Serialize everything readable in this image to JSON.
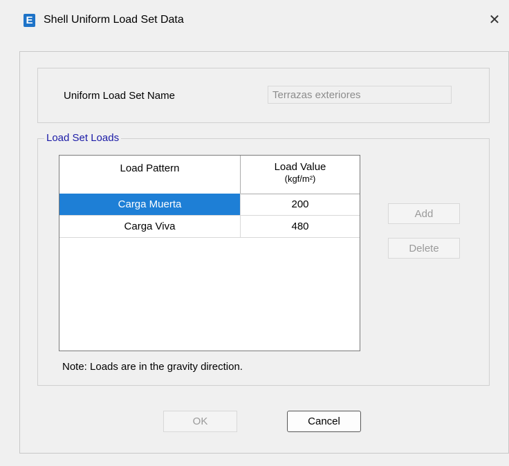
{
  "window": {
    "title": "Shell Uniform Load Set Data",
    "app_icon_letter": "E",
    "close_glyph": "✕"
  },
  "name_panel": {
    "label": "Uniform Load Set Name",
    "value": "Terrazas exteriores"
  },
  "load_set": {
    "group_title": "Load Set Loads",
    "columns": [
      "Load Pattern",
      "Load Value",
      "(kgf/m²)"
    ],
    "rows": [
      {
        "pattern": "Carga Muerta",
        "value": "200",
        "selected": true
      },
      {
        "pattern": "Carga Viva",
        "value": "480",
        "selected": false
      }
    ],
    "add_label": "Add",
    "delete_label": "Delete",
    "note": "Note:  Loads are in the gravity direction."
  },
  "footer": {
    "ok_label": "OK",
    "cancel_label": "Cancel"
  },
  "colors": {
    "selection": "#1e7fd6",
    "group_title": "#1a1aa6",
    "app_icon": "#1e73c8"
  }
}
